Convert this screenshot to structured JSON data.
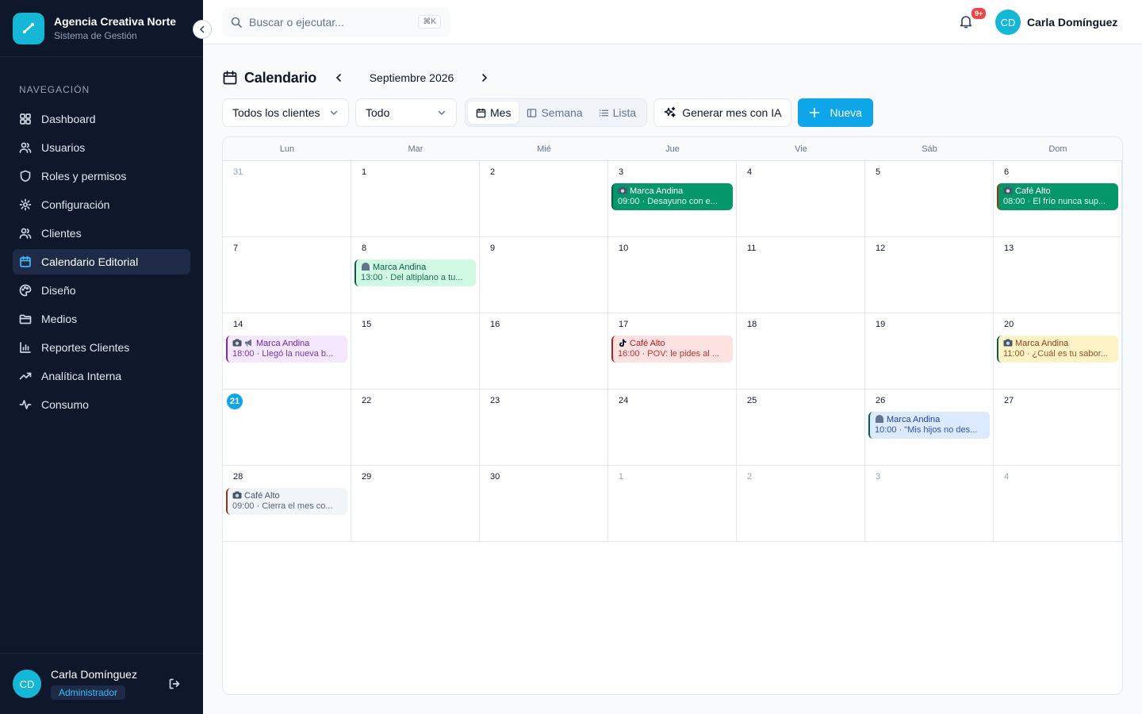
{
  "sidebar": {
    "brand_name": "Agencia Creativa Norte",
    "brand_sub": "Sistema de Gestión",
    "nav_heading": "NAVEGACIÓN",
    "items": [
      {
        "label": "Dashboard",
        "icon": "dashboard-icon"
      },
      {
        "label": "Usuarios",
        "icon": "users-icon"
      },
      {
        "label": "Roles y permisos",
        "icon": "shield-icon"
      },
      {
        "label": "Configuración",
        "icon": "gear-icon"
      },
      {
        "label": "Clientes",
        "icon": "clients-icon"
      },
      {
        "label": "Calendario Editorial",
        "icon": "calendar-icon",
        "active": true
      },
      {
        "label": "Diseño",
        "icon": "palette-icon"
      },
      {
        "label": "Medios",
        "icon": "folder-icon"
      },
      {
        "label": "Reportes Clientes",
        "icon": "bar-chart-icon"
      },
      {
        "label": "Analítica Interna",
        "icon": "trend-icon"
      },
      {
        "label": "Consumo",
        "icon": "activity-icon"
      }
    ],
    "user": {
      "initials": "CD",
      "name": "Carla Domínguez",
      "role": "Administrador"
    }
  },
  "topbar": {
    "search_placeholder": "Buscar o ejecutar...",
    "search_shortcut": "⌘K",
    "notif_count": "9+",
    "user_initials": "CD",
    "user_name": "Carla Domínguez"
  },
  "calendar": {
    "title": "Calendario",
    "month_label": "Septiembre 2026",
    "filter_client": "Todos los clientes",
    "filter_type": "Todo",
    "views": {
      "month": "Mes",
      "week": "Semana",
      "list": "Lista"
    },
    "ai_button": "Generar mes con IA",
    "new_button": "Nueva",
    "weekdays": [
      "Lun",
      "Mar",
      "Mié",
      "Jue",
      "Vie",
      "Sáb",
      "Dom"
    ],
    "days": [
      "31",
      "1",
      "2",
      "3",
      "4",
      "5",
      "6",
      "7",
      "8",
      "9",
      "10",
      "11",
      "12",
      "13",
      "14",
      "15",
      "16",
      "17",
      "18",
      "19",
      "20",
      "21",
      "22",
      "23",
      "24",
      "25",
      "26",
      "27",
      "28",
      "29",
      "30",
      "1",
      "2",
      "3",
      "4"
    ],
    "events": {
      "3": {
        "client": "Marca Andina",
        "detail": "09:00 · Desayuno con e..."
      },
      "6": {
        "client": "Café Alto",
        "detail": "08:00 · El frío nunca sup..."
      },
      "8": {
        "client": "Marca Andina",
        "detail": "13:00 · Del altiplano a tu..."
      },
      "14": {
        "client": "Marca Andina",
        "detail": "18:00 · Llegó la nueva b..."
      },
      "17": {
        "client": "Café Alto",
        "detail": "16:00 · POV: le pides al ..."
      },
      "20": {
        "client": "Marca Andina",
        "detail": "11:00 · ¿Cuál es tu sabor..."
      },
      "26": {
        "client": "Marca Andina",
        "detail": "10:00 · \"Mis hijos no des..."
      },
      "28": {
        "client": "Café Alto",
        "detail": "09:00 · Cierra el mes co..."
      }
    },
    "colors": {
      "accent": "#0ea5e9",
      "green_solid": "#059669",
      "green_light": "#d1fae5",
      "purple_light": "#f3e8ff",
      "red_light": "#fee2e2",
      "amber_light": "#fef3c7",
      "blue_light": "#dbeafe",
      "gray_light": "#f1f5f9"
    }
  }
}
